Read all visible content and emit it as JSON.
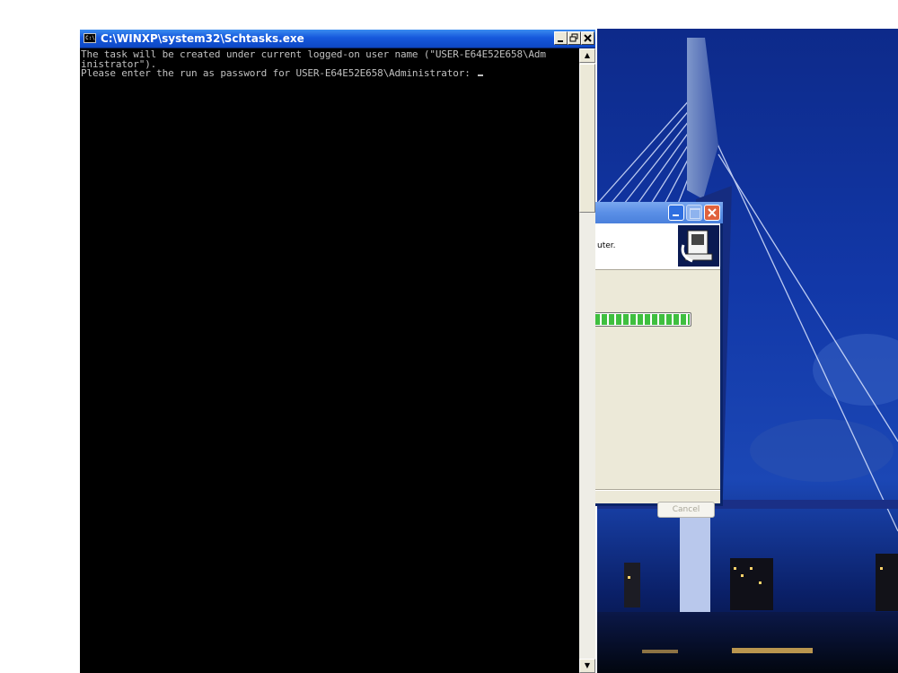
{
  "console": {
    "title": "C:\\WINXP\\system32\\Schtasks.exe",
    "icon": "console-icon",
    "lines": [
      "The task will be created under current logged-on user name (\"USER-E64E52E658\\Adm",
      "inistrator\").",
      "Please enter the run as password for USER-E64E52E658\\Administrator: "
    ],
    "buttons": {
      "minimize": "_",
      "restore": "3",
      "close": "×"
    }
  },
  "dialog": {
    "message": "uter.",
    "progress_percent": 100,
    "cancel_label": "Cancel"
  },
  "colors": {
    "titlebar_active": "#0d47c4",
    "console_text": "#c0c0c0",
    "progress_green": "#3fbf3f"
  }
}
